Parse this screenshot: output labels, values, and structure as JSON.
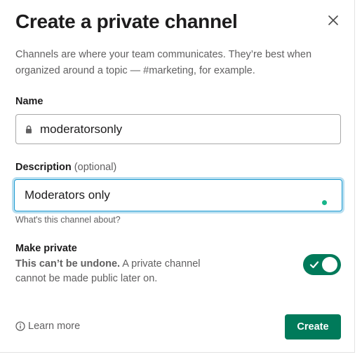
{
  "dialog": {
    "title": "Create a private channel",
    "intro": "Channels are where your team communicates. They’re best when organized around a topic — #marketing, for example.",
    "close_icon": "close-icon"
  },
  "name_field": {
    "label": "Name",
    "value": "moderatorsonly",
    "icon": "lock-icon"
  },
  "description_field": {
    "label": "Description",
    "optional_label": "(optional)",
    "value": "Moderators only",
    "hint": "What's this channel about?"
  },
  "make_private": {
    "title": "Make private",
    "desc_bold": "This can’t be undone.",
    "desc_rest": " A private channel cannot be made public later on.",
    "enabled": true
  },
  "footer": {
    "learn_more": "Learn more",
    "learn_more_icon": "info-icon",
    "create_label": "Create"
  },
  "colors": {
    "accent": "#007a5a",
    "focus_ring": "#1d9bd1",
    "text": "#1d1c1d",
    "muted": "#616061"
  }
}
